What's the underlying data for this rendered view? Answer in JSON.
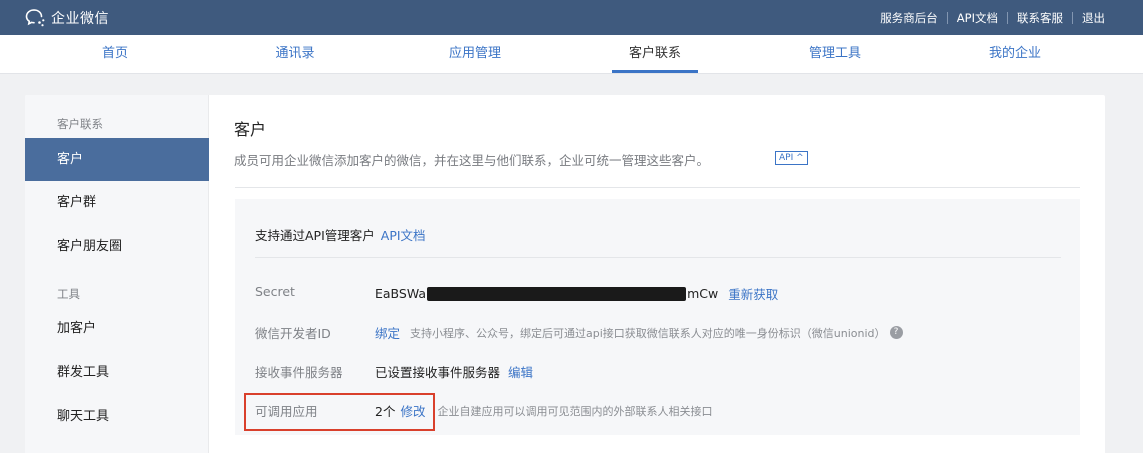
{
  "brand": {
    "name": "企业微信"
  },
  "top_links": [
    "服务商后台",
    "API文档",
    "联系客服",
    "退出"
  ],
  "nav": {
    "tabs": [
      {
        "label": "首页",
        "active": false
      },
      {
        "label": "通讯录",
        "active": false
      },
      {
        "label": "应用管理",
        "active": false
      },
      {
        "label": "客户联系",
        "active": true
      },
      {
        "label": "管理工具",
        "active": false
      },
      {
        "label": "我的企业",
        "active": false
      }
    ]
  },
  "sidebar": {
    "group1": "客户联系",
    "items1": [
      {
        "label": "客户",
        "active": true
      },
      {
        "label": "客户群",
        "active": false
      },
      {
        "label": "客户朋友圈",
        "active": false
      }
    ],
    "group2": "工具",
    "items2": [
      {
        "label": "加客户"
      },
      {
        "label": "群发工具"
      },
      {
        "label": "聊天工具"
      }
    ]
  },
  "main": {
    "title": "客户",
    "description": "成员可用企业微信添加客户的微信，并在这里与他们联系，企业可统一管理这些客户。",
    "api_badge": "API ^",
    "api_box": {
      "heading": "支持通过API管理客户",
      "heading_link": "API文档",
      "secret": {
        "label": "Secret",
        "prefix": "EaBSWa",
        "suffix": "mCw",
        "action": "重新获取"
      },
      "developer_id": {
        "label": "微信开发者ID",
        "action": "绑定",
        "hint": "支持小程序、公众号，绑定后可通过api接口获取微信联系人对应的唯一身份标识（微信unionid）",
        "help_icon": "?"
      },
      "event_server": {
        "label": "接收事件服务器",
        "value": "已设置接收事件服务器",
        "action": "编辑"
      },
      "apps": {
        "label": "可调用应用",
        "value": "2个",
        "action": "修改",
        "hint": "企业自建应用可以调用可见范围内的外部联系人相关接口"
      }
    }
  },
  "colors": {
    "topbar": "#3f5a7e",
    "accent": "#3b74c6",
    "sidebar_active": "#4a6d9d",
    "highlight": "#d9402c"
  }
}
